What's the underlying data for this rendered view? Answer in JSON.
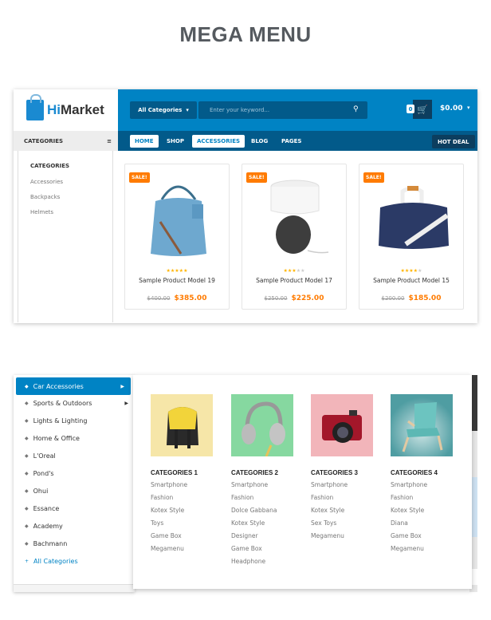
{
  "page_title": "MEGA MENU",
  "header": {
    "logo": {
      "prefix": "Hi",
      "suffix": "Market"
    },
    "category_select": "All Categories",
    "search_placeholder": "Enter your keyword...",
    "cart_count": "0",
    "cart_total": "$0.00",
    "brand_color": "#0083c4",
    "accent_color": "#ff7b00"
  },
  "nav": {
    "categories_toggle": "CATEGORIES",
    "items": [
      {
        "label": "HOME",
        "active": true
      },
      {
        "label": "SHOP",
        "active": false
      },
      {
        "label": "ACCESSORIES",
        "active": true
      },
      {
        "label": "BLOG",
        "active": false
      },
      {
        "label": "PAGES",
        "active": false
      }
    ],
    "hot_deal": "HOT DEAL"
  },
  "accessories_menu": {
    "heading": "CATEGORIES",
    "links": [
      "Accessories",
      "Backpacks",
      "Helmets"
    ],
    "products": [
      {
        "badge": "SALE!",
        "name": "Sample Product Model 19",
        "old_price": "$400.00",
        "price": "$385.00",
        "rating": 5,
        "image": "blue-handbag"
      },
      {
        "badge": "SALE!",
        "name": "Sample Product Model 17",
        "old_price": "$250.00",
        "price": "$225.00",
        "rating": 3,
        "image": "table-lamp"
      },
      {
        "badge": "SALE!",
        "name": "Sample Product Model 15",
        "old_price": "$200.00",
        "price": "$185.00",
        "rating": 4,
        "image": "navy-duffel-bag"
      }
    ]
  },
  "vertical_menu": {
    "items": [
      {
        "label": "Car Accessories",
        "active": true,
        "has_submenu": true
      },
      {
        "label": "Sports & Outdoors",
        "active": false,
        "has_submenu": true
      },
      {
        "label": "Lights & Lighting",
        "active": false,
        "has_submenu": false
      },
      {
        "label": "Home & Office",
        "active": false,
        "has_submenu": false
      },
      {
        "label": "L'Oreal",
        "active": false,
        "has_submenu": false
      },
      {
        "label": "Pond's",
        "active": false,
        "has_submenu": false
      },
      {
        "label": "Ohui",
        "active": false,
        "has_submenu": false
      },
      {
        "label": "Essance",
        "active": false,
        "has_submenu": false
      },
      {
        "label": "Academy",
        "active": false,
        "has_submenu": false
      },
      {
        "label": "Bachmann",
        "active": false,
        "has_submenu": false
      }
    ],
    "all_categories": "All Categories"
  },
  "mega_columns": [
    {
      "heading": "CATEGORIES 1",
      "image": "yellow-backpack",
      "bg": "#f6e6a8",
      "links": [
        "Smartphone",
        "Fashion",
        "Kotex Style",
        "Toys",
        "Game Box",
        "Megamenu"
      ]
    },
    {
      "heading": "CATEGORIES 2",
      "image": "headphones",
      "bg": "#86d8a0",
      "links": [
        "Smartphone",
        "Fashion",
        "Dolce Gabbana",
        "Kotex Style",
        "Designer",
        "Game Box",
        "Headphone"
      ]
    },
    {
      "heading": "CATEGORIES 3",
      "image": "red-camera",
      "bg": "#f2b5ba",
      "links": [
        "Smartphone",
        "Fashion",
        "Kotex Style",
        "Sex Toys",
        "Megamenu"
      ]
    },
    {
      "heading": "CATEGORIES 4",
      "image": "teal-armchair",
      "bg": "#4f9da2",
      "links": [
        "Smartphone",
        "Fashion",
        "Kotex Style",
        "Diana",
        "Game Box",
        "Megamenu"
      ]
    }
  ]
}
